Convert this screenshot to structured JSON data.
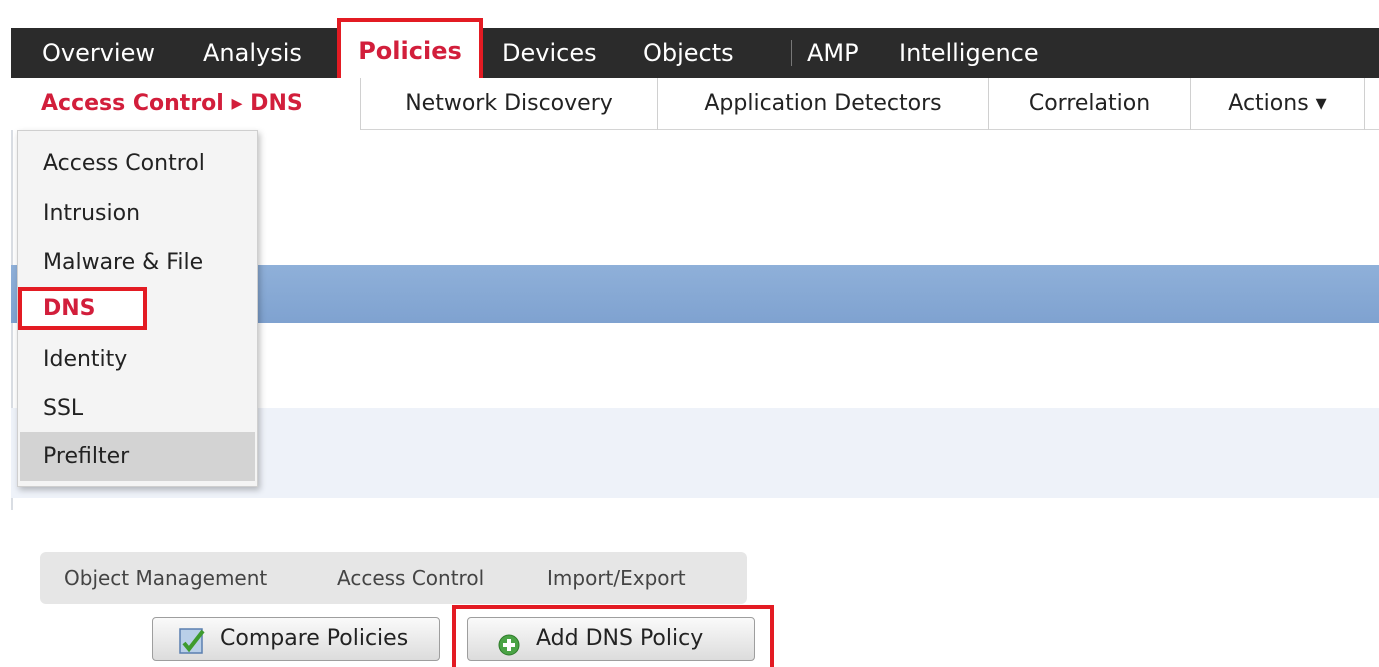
{
  "topnav": {
    "items": [
      "Overview",
      "Analysis",
      "Devices",
      "Objects",
      "AMP",
      "Intelligence"
    ],
    "active": "Policies"
  },
  "subnav": {
    "active_label": "Access Control ▸ DNS",
    "items": [
      "Network Discovery",
      "Application Detectors",
      "Correlation",
      "Actions ▾"
    ]
  },
  "dropdown": {
    "items": [
      "Access Control",
      "Intrusion",
      "Malware & File",
      "DNS",
      "Identity",
      "SSL",
      "Prefilter"
    ]
  },
  "toolbar": {
    "links": [
      "Object Management",
      "Access Control",
      "Import/Export"
    ],
    "compare_label": "Compare Policies",
    "add_label": "Add DNS Policy"
  },
  "colors": {
    "nav_bg": "#2b2b2b",
    "accent_red": "#e31b23",
    "active_text_red": "#d21e3b",
    "row_blue": "#8fb0d9"
  }
}
